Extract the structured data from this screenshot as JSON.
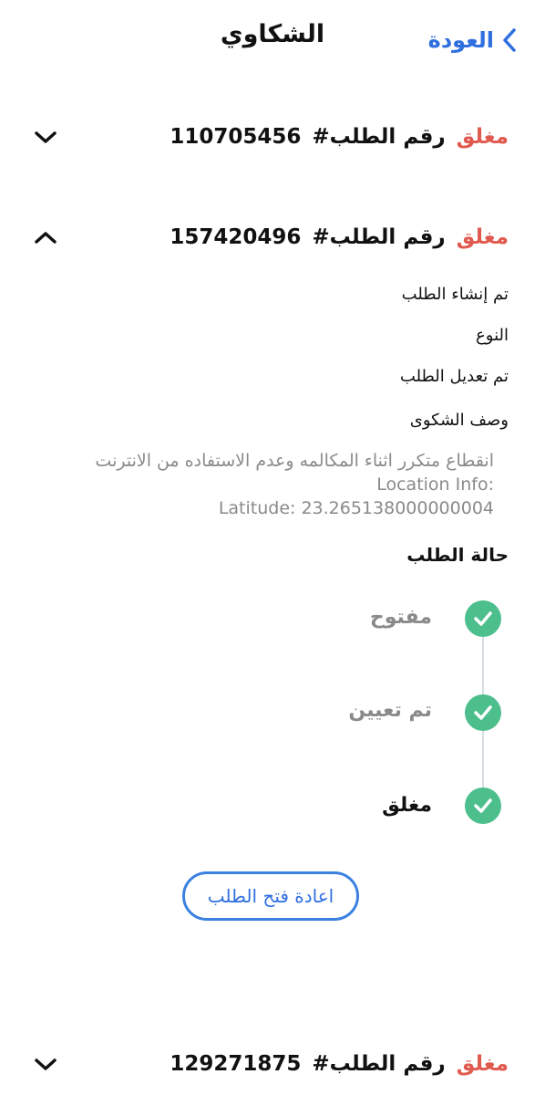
{
  "header": {
    "back_label": "العودة",
    "title": "الشكاوي"
  },
  "requests": [
    {
      "status": "مغلق",
      "label": "رقم الطلب#",
      "number": "110705456",
      "expanded": false
    },
    {
      "status": "مغلق",
      "label": "رقم الطلب#",
      "number": "157420496",
      "expanded": true,
      "details": {
        "created_label": "تم إنشاء الطلب",
        "type_label": "النوع",
        "modified_label": "تم تعديل الطلب",
        "description_label": "وصف الشكوى",
        "description_lines": [
          "انقطاع متكرر اثناء المكالمه وعدم الاستفاده من الانترنت",
          "Location Info:",
          "Latitude: 23.265138000000004"
        ],
        "status_title": "حالة الطلب",
        "timeline": [
          {
            "label": "مفتوح",
            "state": "done"
          },
          {
            "label": "تم تعيين",
            "state": "done"
          },
          {
            "label": "مغلق",
            "state": "current"
          }
        ],
        "reopen_label": "اعادة فتح الطلب"
      }
    },
    {
      "status": "مغلق",
      "label": "رقم الطلب#",
      "number": "129271875",
      "expanded": false
    }
  ],
  "colors": {
    "accent": "#2f6fe0",
    "status_closed": "#e05a4f",
    "check_green": "#4cbf8d",
    "muted_text": "#8a8a8a"
  },
  "icons": {
    "back": "chevron-left-icon",
    "collapsed": "chevron-down-icon",
    "expanded": "chevron-up-icon",
    "step_done": "check-icon"
  }
}
